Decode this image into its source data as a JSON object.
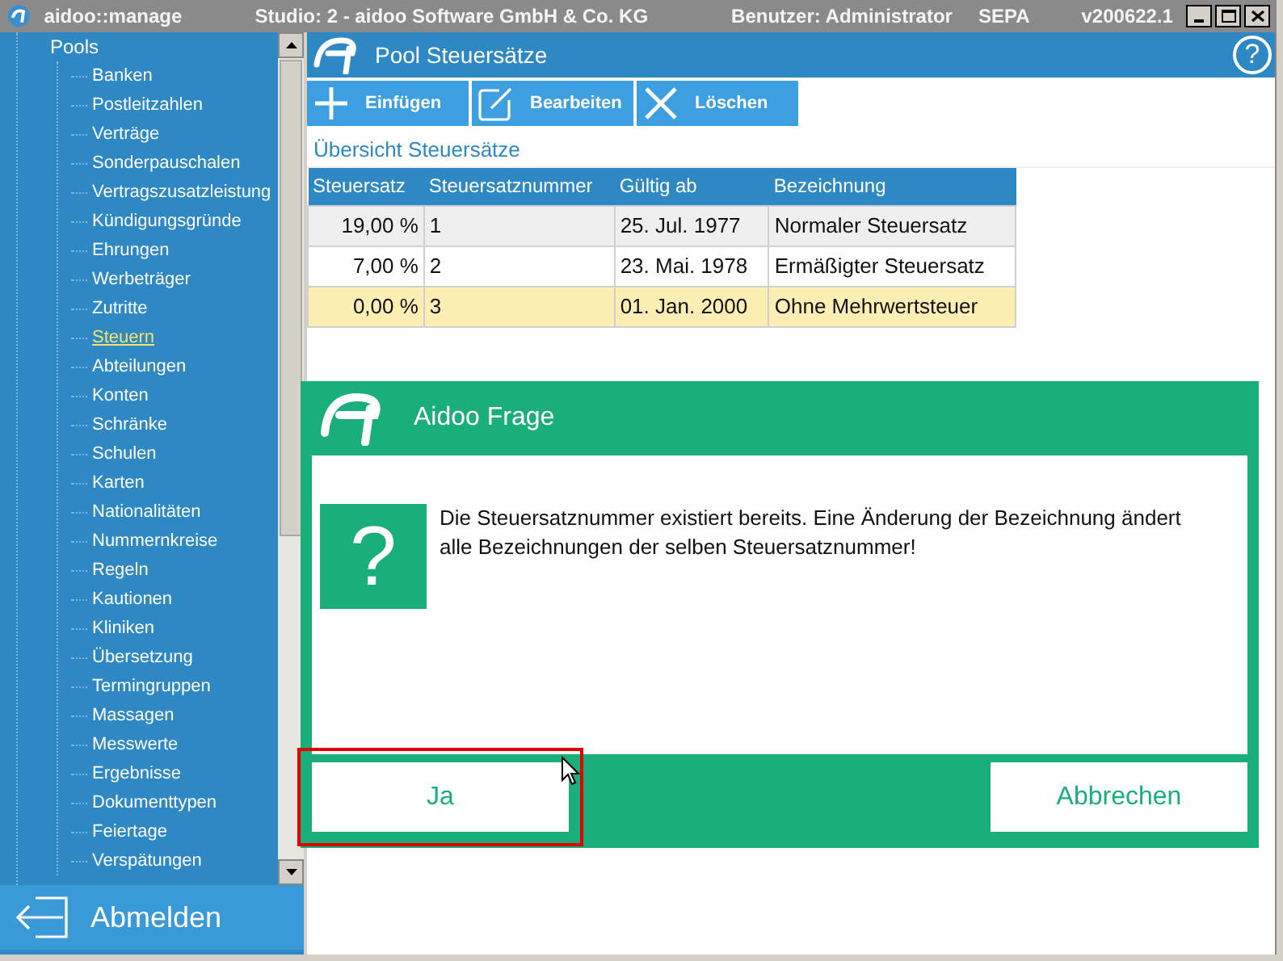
{
  "window": {
    "title": "aidoo::manage",
    "studio": "Studio: 2 - aidoo Software GmbH & Co. KG",
    "user": "Benutzer: Administrator",
    "mode": "SEPA",
    "version": "v200622.1"
  },
  "sidebar": {
    "root": "Pools",
    "items": [
      {
        "label": "Banken",
        "selected": false
      },
      {
        "label": "Postleitzahlen",
        "selected": false
      },
      {
        "label": "Verträge",
        "selected": false
      },
      {
        "label": "Sonderpauschalen",
        "selected": false
      },
      {
        "label": "Vertragszusatzleistung",
        "selected": false
      },
      {
        "label": "Kündigungsgründe",
        "selected": false
      },
      {
        "label": "Ehrungen",
        "selected": false
      },
      {
        "label": "Werbeträger",
        "selected": false
      },
      {
        "label": "Zutritte",
        "selected": false
      },
      {
        "label": "Steuern",
        "selected": true
      },
      {
        "label": "Abteilungen",
        "selected": false
      },
      {
        "label": "Konten",
        "selected": false
      },
      {
        "label": "Schränke",
        "selected": false
      },
      {
        "label": "Schulen",
        "selected": false
      },
      {
        "label": "Karten",
        "selected": false
      },
      {
        "label": "Nationalitäten",
        "selected": false
      },
      {
        "label": "Nummernkreise",
        "selected": false
      },
      {
        "label": "Regeln",
        "selected": false
      },
      {
        "label": "Kautionen",
        "selected": false
      },
      {
        "label": "Kliniken",
        "selected": false
      },
      {
        "label": "Übersetzung",
        "selected": false
      },
      {
        "label": "Termingruppen",
        "selected": false
      },
      {
        "label": "Massagen",
        "selected": false
      },
      {
        "label": "Messwerte",
        "selected": false
      },
      {
        "label": "Ergebnisse",
        "selected": false
      },
      {
        "label": "Dokumenttypen",
        "selected": false
      },
      {
        "label": "Feiertage",
        "selected": false
      },
      {
        "label": "Verspätungen",
        "selected": false
      }
    ],
    "logout": "Abmelden"
  },
  "header": {
    "title": "Pool Steuersätze",
    "help": "?"
  },
  "toolbar": [
    {
      "label": "Einfügen",
      "kind": "add"
    },
    {
      "label": "Bearbeiten",
      "kind": "edit"
    },
    {
      "label": "Löschen",
      "kind": "delete"
    }
  ],
  "section_title": "Übersicht Steuersätze",
  "table": {
    "columns": [
      "Steuersatz",
      "Steuersatznummer",
      "Gültig ab",
      "Bezeichnung"
    ],
    "rows": [
      {
        "cells": [
          "19,00 %",
          "1",
          "25. Jul. 1977",
          "Normaler Steuersatz"
        ],
        "selected": false
      },
      {
        "cells": [
          "7,00 %",
          "2",
          "23. Mai. 1978",
          "Ermäßigter Steuersatz"
        ],
        "selected": false
      },
      {
        "cells": [
          "0,00 %",
          "3",
          "01. Jan. 2000",
          "Ohne Mehrwertsteuer"
        ],
        "selected": true
      }
    ]
  },
  "dialog": {
    "title": "Aidoo Frage",
    "icon": "?",
    "message": "Die Steuersatznummer existiert bereits. Eine Änderung der Bezeichnung ändert alle Bezeichnungen der selben Steuersatznummer!",
    "buttons": [
      {
        "label": "Ja",
        "highlighted": true
      },
      {
        "label": "Abbrechen",
        "highlighted": false
      }
    ]
  }
}
